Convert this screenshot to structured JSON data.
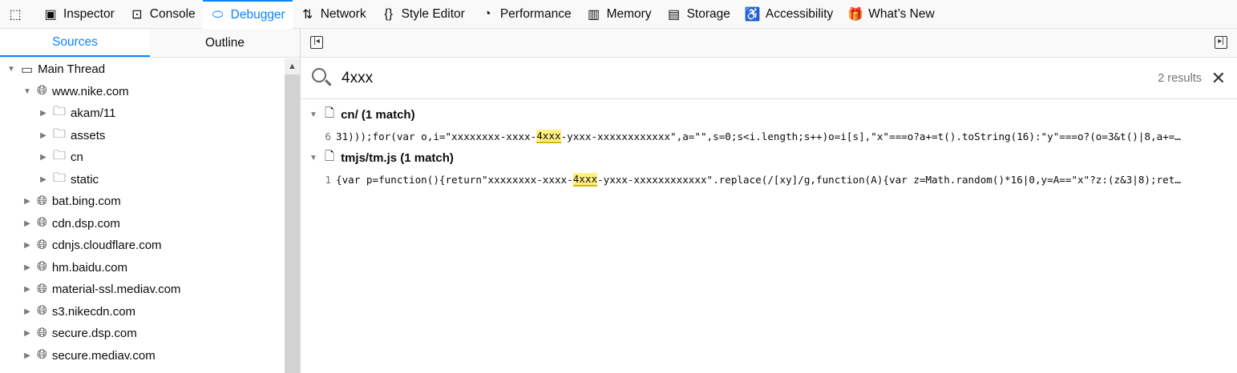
{
  "toolbar": {
    "items": [
      {
        "label": "",
        "icon": "pick-element-icon"
      },
      {
        "label": "Inspector",
        "icon": "inspector-icon"
      },
      {
        "label": "Console",
        "icon": "console-icon"
      },
      {
        "label": "Debugger",
        "icon": "debugger-icon",
        "active": true
      },
      {
        "label": "Network",
        "icon": "network-icon"
      },
      {
        "label": "Style Editor",
        "icon": "style-editor-icon"
      },
      {
        "label": "Performance",
        "icon": "performance-icon"
      },
      {
        "label": "Memory",
        "icon": "memory-icon"
      },
      {
        "label": "Storage",
        "icon": "storage-icon"
      },
      {
        "label": "Accessibility",
        "icon": "accessibility-icon"
      },
      {
        "label": "What’s New",
        "icon": "gift-icon"
      }
    ]
  },
  "left": {
    "tabs": [
      "Sources",
      "Outline"
    ],
    "tree": [
      {
        "label": "Main Thread",
        "depth": 0,
        "type": "window",
        "open": true
      },
      {
        "label": "www.nike.com",
        "depth": 1,
        "type": "globe",
        "open": true
      },
      {
        "label": "akam/11",
        "depth": 2,
        "type": "folder"
      },
      {
        "label": "assets",
        "depth": 2,
        "type": "folder"
      },
      {
        "label": "cn",
        "depth": 2,
        "type": "folder"
      },
      {
        "label": "static",
        "depth": 2,
        "type": "folder"
      },
      {
        "label": "bat.bing.com",
        "depth": 1,
        "type": "globe"
      },
      {
        "label": "cdn.dsp.com",
        "depth": 1,
        "type": "globe"
      },
      {
        "label": "cdnjs.cloudflare.com",
        "depth": 1,
        "type": "globe"
      },
      {
        "label": "hm.baidu.com",
        "depth": 1,
        "type": "globe"
      },
      {
        "label": "material-ssl.mediav.com",
        "depth": 1,
        "type": "globe"
      },
      {
        "label": "s3.nikecdn.com",
        "depth": 1,
        "type": "globe"
      },
      {
        "label": "secure.dsp.com",
        "depth": 1,
        "type": "globe"
      },
      {
        "label": "secure.mediav.com",
        "depth": 1,
        "type": "globe"
      }
    ]
  },
  "search": {
    "query": "4xxx",
    "results": "2 results"
  },
  "results": [
    {
      "file": "cn/ (1 match)",
      "line": "6",
      "pre": "31)));for(var o,i=\"xxxxxxxx-xxxx-",
      "match": "4xxx",
      "post": "-yxxx-xxxxxxxxxxxx\",a=\"\",s=0;s<i.length;s++)o=i[s],\"x\"===o?a+=t().toString(16):\"y\"===o?(o=3&t()|8,a+=…"
    },
    {
      "file": "tmjs/tm.js (1 match)",
      "line": "1",
      "pre": "{var p=function(){return\"xxxxxxxx-xxxx-",
      "match": "4xxx",
      "post": "-yxxx-xxxxxxxxxxxx\".replace(/[xy]/g,function(A){var z=Math.random()*16|0,y=A==\"x\"?z:(z&3|8);ret…"
    }
  ]
}
